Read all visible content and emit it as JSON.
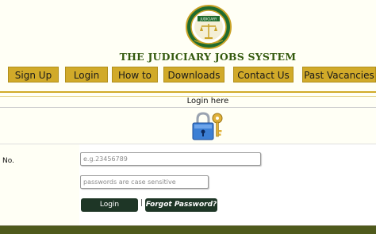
{
  "header": {
    "site_title": "THE JUDICIARY JOBS SYSTEM",
    "logo_text": "JUDICIARY"
  },
  "nav": {
    "items": [
      {
        "label": "Sign Up"
      },
      {
        "label": "Login"
      },
      {
        "label": "How to"
      },
      {
        "label": "Downloads"
      },
      {
        "label": "Contact Us"
      },
      {
        "label": "Past Vacancies"
      }
    ]
  },
  "login": {
    "heading": "Login here",
    "id_label": "No.",
    "id_placeholder": "e.g.23456789",
    "password_placeholder": "passwords are case sensitive",
    "submit_label": "Login",
    "separator": "|",
    "forgot_label": "Forgot Password?"
  },
  "colors": {
    "background": "#fffff5",
    "nav_button": "#d1aa29",
    "title_green": "#345a0e",
    "button_dark": "#1e3626",
    "footer": "#4f5a1c"
  }
}
